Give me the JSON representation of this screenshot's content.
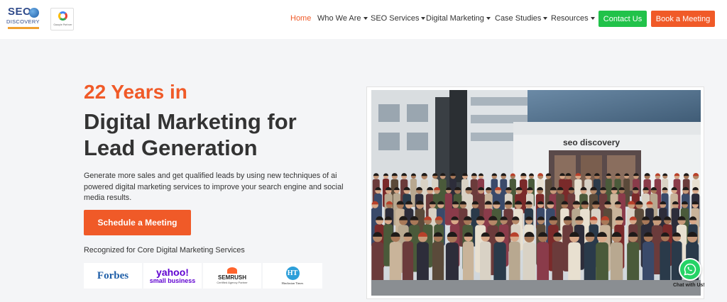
{
  "header": {
    "logo": {
      "line1": "SEO",
      "line2": "DISCOVERY"
    },
    "google_partner": "Google Partner",
    "nav": [
      {
        "label": "Home",
        "active": true
      },
      {
        "label": "Who We Are",
        "dropdown": true
      },
      {
        "label": "SEO Services",
        "dropdown": true
      },
      {
        "label": "Digital Marketing",
        "dropdown": true
      },
      {
        "label": "Case Studies",
        "dropdown": true
      },
      {
        "label": "Resources",
        "dropdown": true
      }
    ],
    "contact_label": "Contact Us",
    "book_label": "Book a Meeting"
  },
  "hero": {
    "years": "22 Years in",
    "title": "Digital Marketing for Lead Generation",
    "description": "Generate more sales and get qualified leads by using new techniques of ai powered digital marketing services to improve your search engine and social media results.",
    "cta_label": "Schedule a Meeting",
    "recognized": "Recognized for Core Digital Marketing Services"
  },
  "badges": {
    "forbes": "Forbes",
    "yahoo_line1": "yahoo!",
    "yahoo_line2": "small business",
    "semrush": "SEMRUSH",
    "semrush_sub": "Certified Agency Partner",
    "ht_logo": "HT",
    "ht_text": "Hindustan Times"
  },
  "photo": {
    "sign": "seo discovery"
  },
  "whatsapp": {
    "label": "Chat with Us!"
  },
  "colors": {
    "accent": "#f05a28",
    "contact_green": "#21c24a",
    "whatsapp": "#25d366"
  }
}
